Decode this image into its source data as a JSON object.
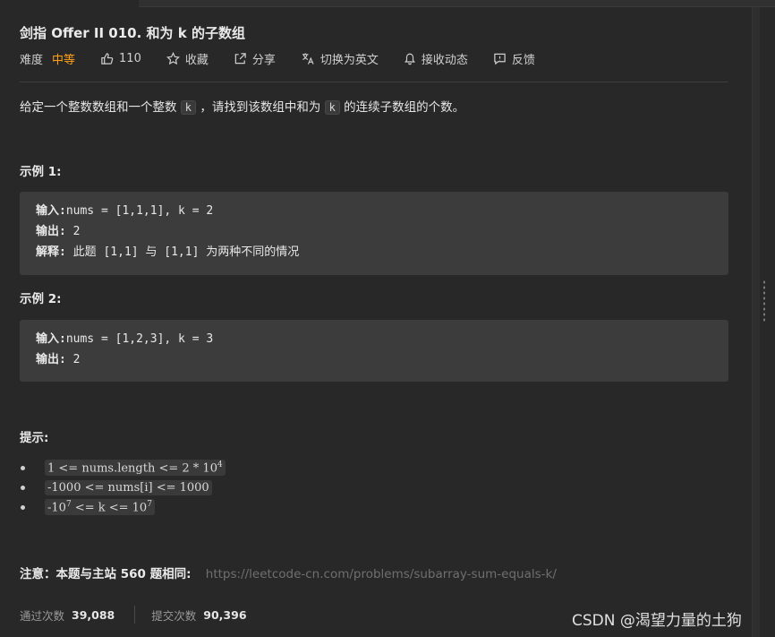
{
  "problem": {
    "title": "剑指 Offer II 010. 和为 k 的子数组",
    "difficulty_label": "难度",
    "difficulty_value": "中等",
    "likes": "110",
    "favorite_label": "收藏",
    "share_label": "分享",
    "switch_lang_label": "切换为英文",
    "subscribe_label": "接收动态",
    "feedback_label": "反馈"
  },
  "description": {
    "part1": "给定一个整数数组和一个整数",
    "k1": "k",
    "part2": "，请找到该数组中和为",
    "k2": "k",
    "part3": "的连续子数组的个数。"
  },
  "examples": [
    {
      "heading": "示例 1:",
      "input_label": "输入:",
      "input_value": "nums = [1,1,1], k = 2",
      "output_label": "输出:",
      "output_value": " 2",
      "explain_label": "解释:",
      "explain_value": " 此题 [1,1] 与 [1,1] 为两种不同的情况"
    },
    {
      "heading": "示例 2:",
      "input_label": "输入:",
      "input_value": "nums = [1,2,3], k = 3",
      "output_label": "输出:",
      "output_value": " 2"
    }
  ],
  "hints": {
    "heading": "提示:",
    "items": [
      {
        "text": "1 <= nums.length <= 2 * 10",
        "sup": "4"
      },
      {
        "text": "-1000 <= nums[i] <= 1000"
      },
      {
        "text": "-10",
        "sup": "7",
        "text2": " <= k <= 10",
        "sup2": "7"
      }
    ]
  },
  "note": {
    "label": "注意：本题与主站 560 题相同:",
    "link": "https://leetcode-cn.com/problems/subarray-sum-equals-k/"
  },
  "stats": {
    "accepted_label": "通过次数",
    "accepted_value": "39,088",
    "submitted_label": "提交次数",
    "submitted_value": "90,396"
  },
  "watermark": "CSDN @渴望力量的土狗",
  "colors": {
    "background": "#282828",
    "difficulty_medium": "#ffa116",
    "code_block": "#3c3c3c"
  },
  "icons": [
    "thumbs-up-icon",
    "star-icon",
    "share-icon",
    "translate-icon",
    "bell-icon",
    "feedback-icon"
  ]
}
